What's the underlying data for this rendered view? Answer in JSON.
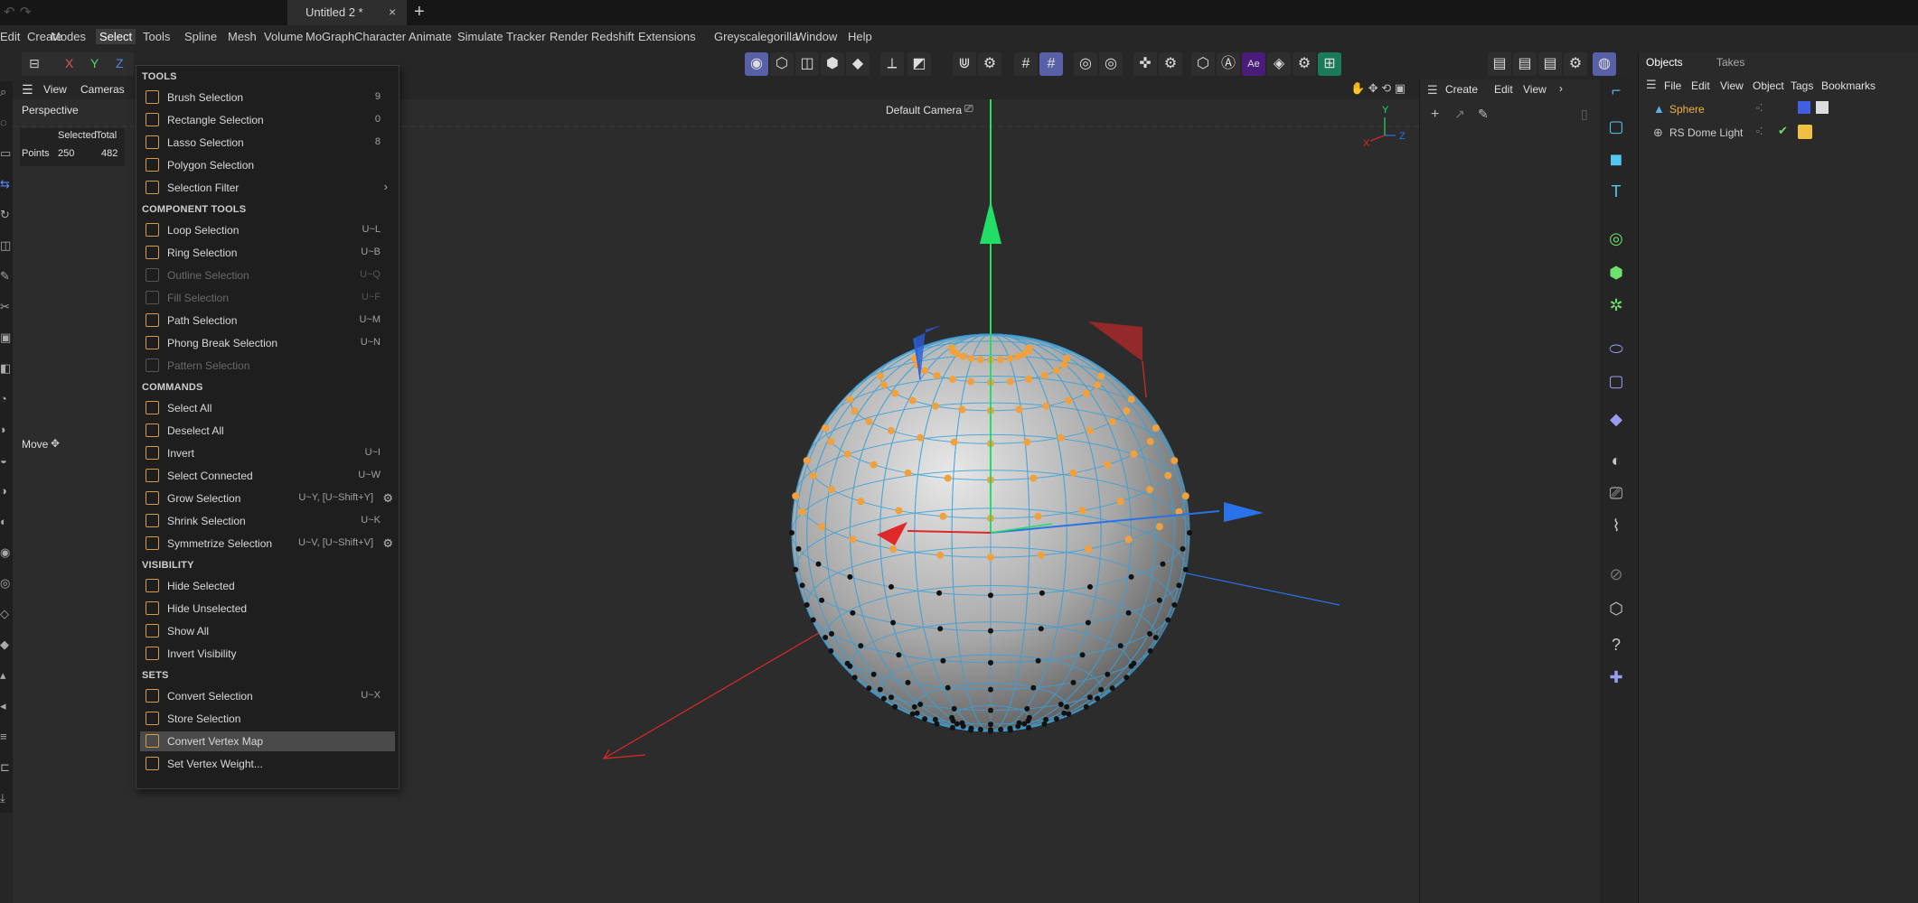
{
  "window": {
    "document_tab": "Untitled 2 *",
    "close_glyph": "×",
    "add_glyph": "+"
  },
  "menubar": [
    "Edit",
    "Create",
    "Modes",
    "Select",
    "Tools",
    "Spline",
    "Mesh",
    "Volume",
    "MoGraph",
    "Character",
    "Animate",
    "Simulate",
    "Tracker",
    "Render",
    "Redshift",
    "Extensions",
    "Greyscalegorilla",
    "Window",
    "Help"
  ],
  "active_menu": "Select",
  "coord_toolbar": {
    "x": "X",
    "y": "Y",
    "z": "Z"
  },
  "viewport": {
    "menu": [
      "View",
      "Cameras"
    ],
    "name": "Perspective",
    "camera": "Default Camera",
    "stats_header": {
      "selected": "Selected",
      "total": "Total"
    },
    "stats_row": {
      "label": "Points",
      "selected": "250",
      "total": "482"
    },
    "tool_label": "Move",
    "axis_labels": {
      "x": "X",
      "y": "Y",
      "z": "Z"
    }
  },
  "mid_panel": {
    "menu": [
      "Create",
      "Edit",
      "View"
    ],
    "more": "›"
  },
  "objects_panel": {
    "tabs": [
      "Objects",
      "Takes"
    ],
    "menu": [
      "File",
      "Edit",
      "View",
      "Object",
      "Tags",
      "Bookmarks"
    ],
    "objects": [
      {
        "name": "Sphere",
        "color": "#f2b23c"
      },
      {
        "name": "RS Dome Light",
        "color": "#cfcfcf"
      }
    ]
  },
  "select_menu": {
    "sections": [
      {
        "title": "TOOLS",
        "items": [
          {
            "label": "Brush Selection",
            "shortcut": "9",
            "enabled": true
          },
          {
            "label": "Rectangle Selection",
            "shortcut": "0",
            "enabled": true
          },
          {
            "label": "Lasso Selection",
            "shortcut": "8",
            "enabled": true
          },
          {
            "label": "Polygon Selection",
            "shortcut": "",
            "enabled": true
          },
          {
            "label": "Selection Filter",
            "shortcut": "",
            "enabled": true,
            "submenu": true
          }
        ]
      },
      {
        "title": "COMPONENT TOOLS",
        "items": [
          {
            "label": "Loop Selection",
            "shortcut": "U~L",
            "enabled": true
          },
          {
            "label": "Ring Selection",
            "shortcut": "U~B",
            "enabled": true
          },
          {
            "label": "Outline Selection",
            "shortcut": "U~Q",
            "enabled": false
          },
          {
            "label": "Fill Selection",
            "shortcut": "U~F",
            "enabled": false
          },
          {
            "label": "Path Selection",
            "shortcut": "U~M",
            "enabled": true
          },
          {
            "label": "Phong Break Selection",
            "shortcut": "U~N",
            "enabled": true
          },
          {
            "label": "Pattern Selection",
            "shortcut": "",
            "enabled": false
          }
        ]
      },
      {
        "title": "COMMANDS",
        "items": [
          {
            "label": "Select All",
            "shortcut": "",
            "enabled": true
          },
          {
            "label": "Deselect All",
            "shortcut": "",
            "enabled": true
          },
          {
            "label": "Invert",
            "shortcut": "U~I",
            "enabled": true
          },
          {
            "label": "Select Connected",
            "shortcut": "U~W",
            "enabled": true
          },
          {
            "label": "Grow Selection",
            "shortcut": "U~Y, [U~Shift+Y]",
            "enabled": true,
            "gear": true
          },
          {
            "label": "Shrink Selection",
            "shortcut": "U~K",
            "enabled": true
          },
          {
            "label": "Symmetrize Selection",
            "shortcut": "U~V, [U~Shift+V]",
            "enabled": true,
            "gear": true
          }
        ]
      },
      {
        "title": "VISIBILITY",
        "items": [
          {
            "label": "Hide Selected",
            "shortcut": "",
            "enabled": true
          },
          {
            "label": "Hide Unselected",
            "shortcut": "",
            "enabled": true
          },
          {
            "label": "Show All",
            "shortcut": "",
            "enabled": true
          },
          {
            "label": "Invert Visibility",
            "shortcut": "",
            "enabled": true
          }
        ]
      },
      {
        "title": "SETS",
        "items": [
          {
            "label": "Convert Selection",
            "shortcut": "U~X",
            "enabled": true
          },
          {
            "label": "Store Selection",
            "shortcut": "",
            "enabled": true
          },
          {
            "label": "Convert Vertex Map",
            "shortcut": "",
            "enabled": true,
            "highlighted": true
          },
          {
            "label": "Set Vertex Weight...",
            "shortcut": "",
            "enabled": true
          }
        ]
      }
    ]
  },
  "colors": {
    "accent_orange": "#f2a03c",
    "wire_blue": "#3aa0d8",
    "y_green": "#22dd66",
    "x_red": "#e02828",
    "z_blue": "#2a72e8"
  }
}
